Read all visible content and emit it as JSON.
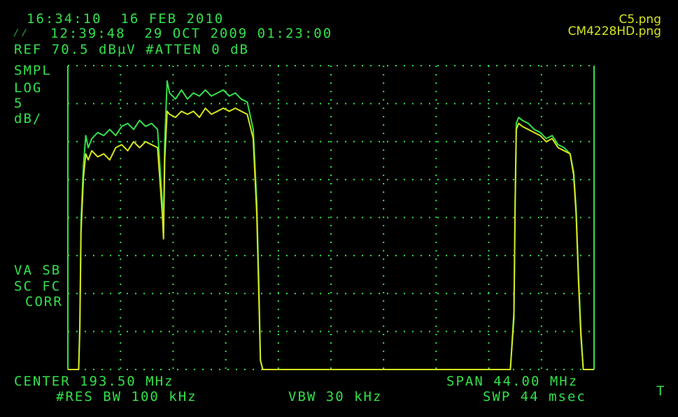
{
  "header": {
    "time_date": "16:34:10  16 FEB 2010",
    "ref_timestamp": "12:39:48  29 OCT 2009 01:23:00",
    "ref_level": "REF 70.5 dBµV #ATTEN 0 dB"
  },
  "file_labels": [
    "C5.png",
    "CM4228HD.png"
  ],
  "left_labels": {
    "mode": "SMPL",
    "scale": "LOG",
    "per_div_value": "5",
    "per_div_unit": "dB/",
    "va_sb": "VA SB",
    "sc_fc": "SC FC",
    "corr": "CORR"
  },
  "footer": {
    "center": "CENTER 193.50 MHz",
    "span": "SPAN 44.00 MHz",
    "res_bw": "#RES BW 100 kHz",
    "vbw": "VBW 30 kHz",
    "swp": "SWP 44 msec",
    "marker_flag": "T"
  },
  "colors": {
    "trace_green": "#33e14a",
    "trace_yellow": "#d6e51e",
    "graticule": "#33e14a",
    "background": "#000000"
  },
  "chart_data": {
    "type": "line",
    "title": "",
    "xlabel": "",
    "ylabel": "",
    "x_unit": "MHz",
    "y_unit": "dBµV",
    "xlim": [
      171.5,
      215.5
    ],
    "ylim": [
      20.5,
      70.5
    ],
    "grid": true,
    "series": [
      {
        "name": "C5.png",
        "color": "#33e14a",
        "x": [
          171.5,
          172.4,
          172.5,
          172.6,
          172.8,
          173.0,
          173.2,
          173.5,
          174.0,
          174.5,
          175.0,
          175.5,
          176.0,
          176.5,
          177.0,
          177.5,
          178.0,
          178.5,
          179.0,
          179.4,
          179.5,
          179.6,
          179.8,
          180.0,
          180.5,
          181.0,
          181.5,
          182.0,
          182.5,
          183.0,
          183.5,
          184.0,
          184.5,
          185.0,
          185.5,
          186.0,
          186.5,
          187.0,
          187.3,
          187.5,
          187.6,
          187.8,
          188.5,
          195.0,
          200.0,
          205.0,
          208.5,
          208.8,
          208.9,
          209.0,
          209.2,
          209.5,
          210.0,
          210.5,
          211.0,
          211.5,
          212.0,
          212.5,
          213.0,
          213.5,
          213.8,
          214.0,
          214.2,
          214.4,
          214.6,
          215.5
        ],
        "y": [
          20.5,
          20.5,
          28.0,
          45.0,
          54.0,
          59.0,
          57.0,
          58.5,
          59.5,
          59.0,
          60.0,
          59.0,
          60.5,
          61.0,
          60.0,
          61.5,
          60.5,
          61.0,
          60.0,
          48.0,
          44.0,
          58.0,
          68.0,
          66.0,
          65.0,
          66.5,
          65.0,
          66.0,
          65.5,
          66.5,
          65.5,
          66.0,
          66.5,
          65.5,
          66.0,
          65.0,
          64.5,
          60.0,
          48.0,
          32.0,
          22.0,
          20.5,
          20.5,
          20.5,
          20.5,
          20.5,
          20.5,
          30.0,
          48.0,
          61.0,
          62.0,
          61.5,
          61.0,
          60.0,
          59.5,
          58.5,
          59.0,
          57.5,
          57.0,
          56.0,
          53.0,
          47.0,
          36.0,
          27.0,
          20.5,
          20.5
        ]
      },
      {
        "name": "CM4228HD.png",
        "color": "#d6e51e",
        "x": [
          171.5,
          172.4,
          172.5,
          172.6,
          172.8,
          173.0,
          173.2,
          173.5,
          174.0,
          174.5,
          175.0,
          175.5,
          176.0,
          176.5,
          177.0,
          177.5,
          178.0,
          178.5,
          179.0,
          179.4,
          179.5,
          179.6,
          179.8,
          180.0,
          180.5,
          181.0,
          181.5,
          182.0,
          182.5,
          183.0,
          183.5,
          184.0,
          184.5,
          185.0,
          185.5,
          186.0,
          186.5,
          187.0,
          187.3,
          187.5,
          187.6,
          187.8,
          188.5,
          195.0,
          200.0,
          205.0,
          208.5,
          208.8,
          208.9,
          209.0,
          209.2,
          209.5,
          210.0,
          210.5,
          211.0,
          211.5,
          212.0,
          212.5,
          213.0,
          213.5,
          213.8,
          214.0,
          214.2,
          214.4,
          214.6,
          215.5
        ],
        "y": [
          20.5,
          20.5,
          27.0,
          43.0,
          52.0,
          56.0,
          55.0,
          56.5,
          55.5,
          56.0,
          55.0,
          57.0,
          57.5,
          56.5,
          58.0,
          57.0,
          58.0,
          57.5,
          57.0,
          46.0,
          42.0,
          55.0,
          63.0,
          62.5,
          62.0,
          63.0,
          62.5,
          63.0,
          62.0,
          63.5,
          62.5,
          63.0,
          63.5,
          63.0,
          63.5,
          63.0,
          62.5,
          58.5,
          46.0,
          30.0,
          22.0,
          20.5,
          20.5,
          20.5,
          20.5,
          20.5,
          20.5,
          29.0,
          47.0,
          60.0,
          61.0,
          60.5,
          60.0,
          59.5,
          59.0,
          58.0,
          58.5,
          57.0,
          56.5,
          56.0,
          52.5,
          46.0,
          35.0,
          26.0,
          20.5,
          20.5
        ]
      }
    ]
  }
}
